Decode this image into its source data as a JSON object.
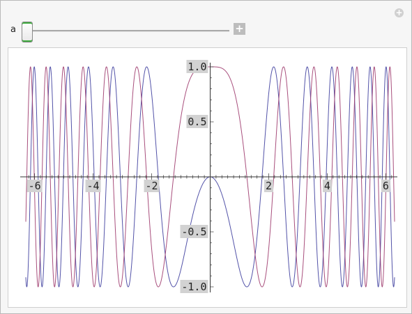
{
  "control": {
    "label": "a"
  },
  "chart_data": {
    "type": "line",
    "x_range": [
      -6.3,
      6.3
    ],
    "y_range": [
      -1.0,
      1.0
    ],
    "x_ticks": [
      -6,
      -4,
      -2,
      2,
      4,
      6
    ],
    "x_tick_labels": [
      "-6",
      "-4",
      "-2",
      "2",
      "4",
      "6"
    ],
    "y_ticks": [
      1.0,
      0.5,
      -0.5,
      -1.0
    ],
    "y_tick_labels": [
      "1.0",
      "0.5",
      "-0.5",
      "-1.0"
    ],
    "series": [
      {
        "color": "#3f3f9f",
        "function": "-sin(x^2)"
      },
      {
        "color": "#9e3b6e",
        "function": "cos(x^2)"
      }
    ]
  }
}
